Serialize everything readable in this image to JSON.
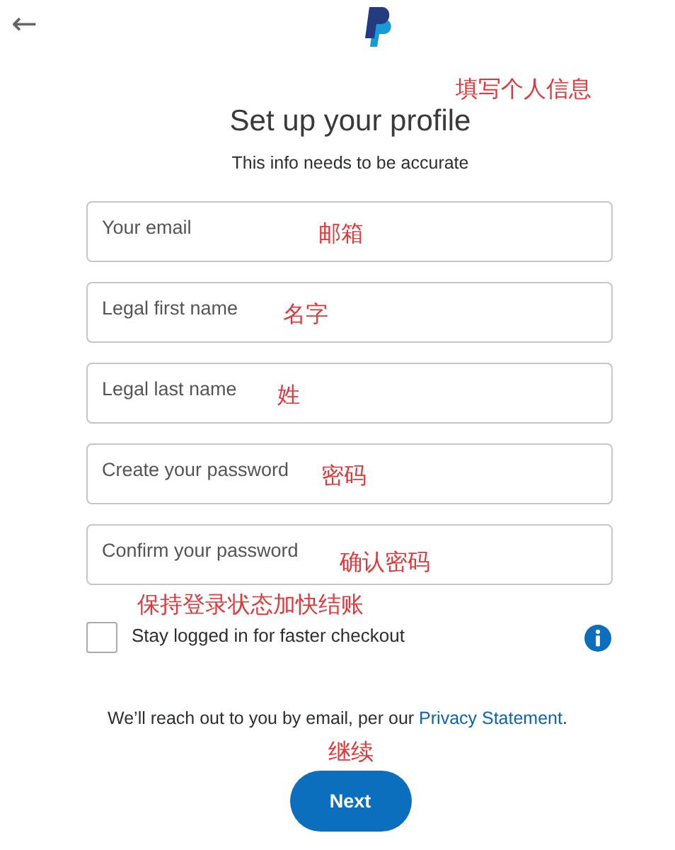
{
  "header": {
    "back": "←"
  },
  "title": "Set up your profile",
  "title_note": "填写个人信息",
  "subtitle": "This info needs to be accurate",
  "fields": [
    {
      "placeholder": "Your email",
      "note": "邮箱"
    },
    {
      "placeholder": "Legal first name",
      "note": "名字"
    },
    {
      "placeholder": "Legal last name",
      "note": "姓"
    },
    {
      "placeholder": "Create your password",
      "note": "密码"
    },
    {
      "placeholder": "Confirm your password",
      "note": "确认密码"
    }
  ],
  "stay_logged_in": {
    "label": "Stay logged in for faster checkout",
    "note": "保持登录状态加快结账",
    "checked": false
  },
  "notice": {
    "text": "We’ll reach out to you by email, per our ",
    "link": "Privacy Statement",
    "end": "."
  },
  "next_button": {
    "label": "Next",
    "note": "继续"
  }
}
